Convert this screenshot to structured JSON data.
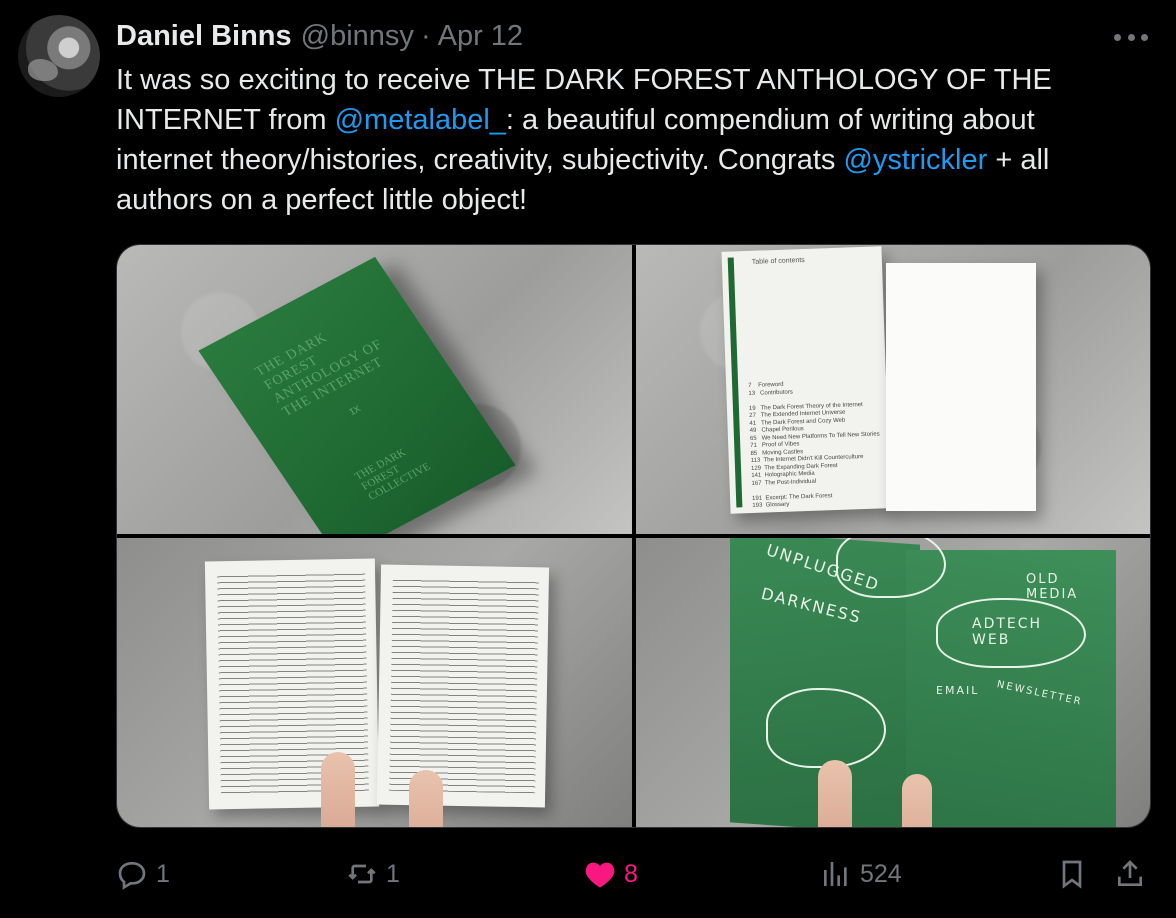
{
  "tweet": {
    "author_name": "Daniel Binns",
    "handle": "@binnsy",
    "separator": "·",
    "date": "Apr 12",
    "text": {
      "line1": "It was so exciting to receive THE DARK FOREST ANTHOLOGY OF THE",
      "line2_pre": "INTERNET from ",
      "mention1": "@metalabel_",
      "line2_post": ":  a beautiful compendium of writing about",
      "line3_pre": "internet theory/histories, creativity, subjectivity. Congrats ",
      "mention2": "@ystrickler",
      "line3_post": " + all",
      "line4": "authors on a perfect little object!"
    }
  },
  "media": {
    "photo1": {
      "cover_title": "THE DARK FOREST ANTHOLOGY OF THE INTERNET",
      "cover_mark": "ɪx",
      "cover_bottom": "THE DARK FOREST COLLECTIVE"
    },
    "photo2": {
      "toc_heading": "Table of contents",
      "toc_rows": "7    Foreword\n13   Contributors\n\n19   The Dark Forest Theory of the Internet\n27   The Extended Internet Universe\n41   The Dark Forest and Cozy Web\n49   Chapel Perilous\n65   We Need New Platforms To Tell New Stories\n71   Proof of Vibes\n85   Moving Castles\n113  The Internet Didn't Kill Counterculture\n129  The Expanding Dark Forest\n141  Holographic Media\n167  The Post-Individual\n\n191  Excerpt: The Dark Forest\n193  Glossary"
    },
    "photo4": {
      "map_label_1": "UNPLUGGED",
      "map_label_2": "DARKNESS",
      "map_label_3": "OLD MEDIA",
      "map_label_4": "ADTECH WEB",
      "map_label_5": "EMAIL",
      "map_label_6": "NEWSLETTER"
    }
  },
  "actions": {
    "replies": "1",
    "reposts": "1",
    "likes": "8",
    "views": "524"
  },
  "colors": {
    "background": "#000000",
    "text": "#e7e9ea",
    "muted": "#71767b",
    "link": "#1d9bf0",
    "like": "#f91880",
    "book_green": "#1f6a33"
  },
  "icons": [
    "more-icon",
    "reply-icon",
    "repost-icon",
    "like-icon",
    "views-icon",
    "bookmark-icon",
    "share-icon"
  ]
}
